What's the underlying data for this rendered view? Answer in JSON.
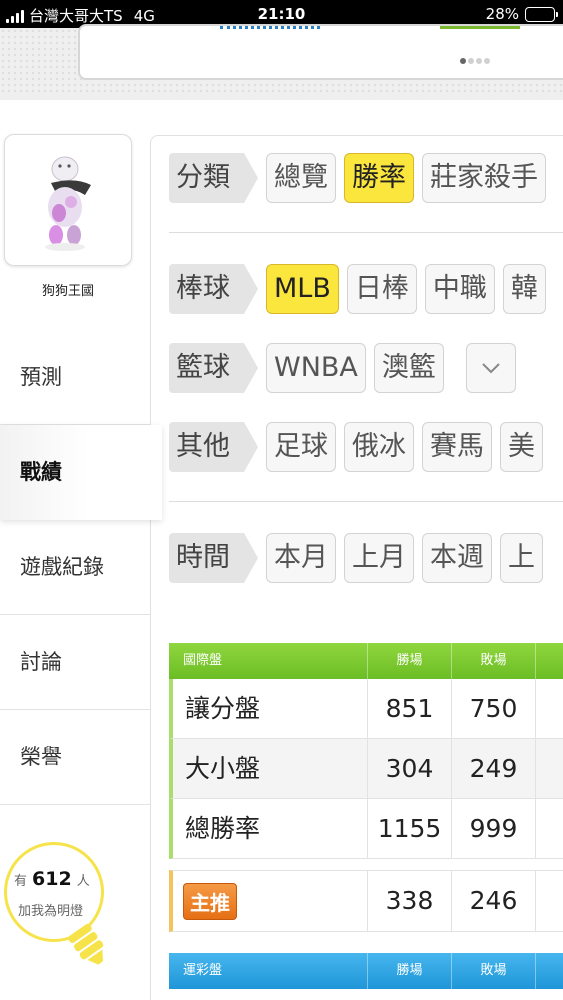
{
  "status_bar": {
    "carrier": "台灣大哥大TS",
    "network": "4G",
    "time": "21:10",
    "battery": "28%",
    "battery_level": 0.28
  },
  "banner": {
    "carousel_pages": 4,
    "carousel_active": 1
  },
  "profile": {
    "username": "狗狗王國"
  },
  "nav": {
    "items": [
      {
        "label": "預測"
      },
      {
        "label": "戰績"
      },
      {
        "label": "遊戲紀錄"
      },
      {
        "label": "討論"
      },
      {
        "label": "榮譽"
      }
    ],
    "active": "戰績"
  },
  "fans": {
    "prefix": "有",
    "count": "612",
    "suffix": "人",
    "line2": "加我為明燈"
  },
  "filters": {
    "category": {
      "label": "分類",
      "options": [
        "總覽",
        "勝率",
        "莊家殺手"
      ],
      "selected": "勝率"
    },
    "baseball": {
      "label": "棒球",
      "options": [
        "MLB",
        "日棒",
        "中職",
        "韓"
      ],
      "selected": "MLB"
    },
    "basketball": {
      "label": "籃球",
      "options": [
        "WNBA",
        "澳籃"
      ]
    },
    "other": {
      "label": "其他",
      "options": [
        "足球",
        "俄冰",
        "賽馬",
        "美"
      ]
    },
    "time": {
      "label": "時間",
      "options": [
        "本月",
        "上月",
        "本週",
        "上"
      ]
    }
  },
  "intl_table": {
    "title": "國際盤",
    "columns": [
      "勝場",
      "敗場"
    ],
    "rows": [
      {
        "label": "讓分盤",
        "wins": "851",
        "losses": "750"
      },
      {
        "label": "大小盤",
        "wins": "304",
        "losses": "249"
      },
      {
        "label": "總勝率",
        "wins": "1155",
        "losses": "999"
      }
    ],
    "colors": {
      "header": "#79c72e",
      "row_accent": "#a9dd6c"
    }
  },
  "main_pick": {
    "badge": "主推",
    "wins": "338",
    "losses": "246",
    "badge_color": "#ef8427"
  },
  "lottery_table": {
    "title": "運彩盤",
    "columns": [
      "勝場",
      "敗場"
    ],
    "header_color": "#2aa5e3"
  }
}
